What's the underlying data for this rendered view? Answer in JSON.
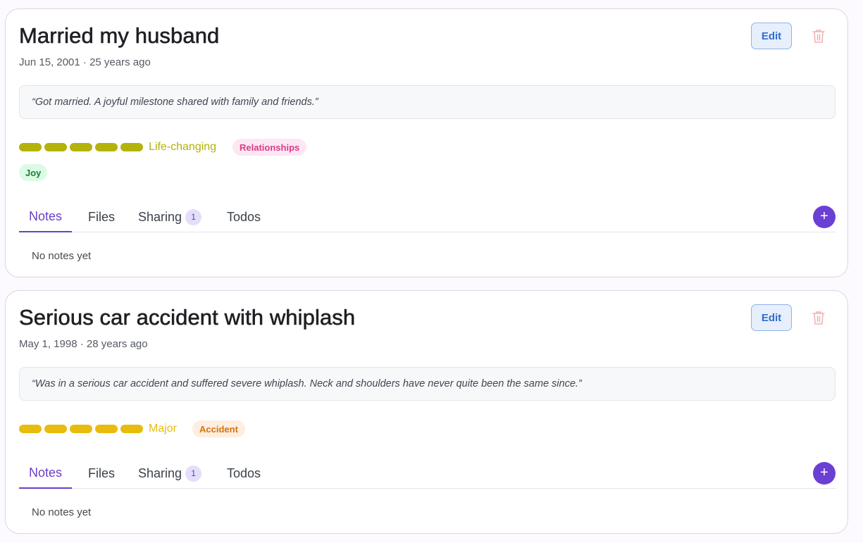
{
  "events": [
    {
      "title": "Married my husband",
      "date": "Jun 15, 2001 · 25 years ago",
      "edit_label": "Edit",
      "quote": "“Got married. A joyful milestone shared with family and friends.”",
      "intensity": {
        "label": "Life-changing",
        "level": 5,
        "max": 5,
        "color": "#b3b30b"
      },
      "category": {
        "label": "Relationships",
        "bg": "#fde7f2",
        "color": "#d63c8a"
      },
      "emotion": {
        "label": "Joy",
        "bg": "#dcfbe4",
        "color": "#1f7a3d"
      },
      "tabs": {
        "notes": "Notes",
        "files": "Files",
        "sharing": "Sharing",
        "sharing_count": "1",
        "todos": "Todos"
      },
      "add_label": "+",
      "empty_text": "No notes yet"
    },
    {
      "title": "Serious car accident with whiplash",
      "date": "May 1, 1998 · 28 years ago",
      "edit_label": "Edit",
      "quote": "“Was in a serious car accident and suffered severe whiplash. Neck and shoulders have never quite been the same since.”",
      "intensity": {
        "label": "Major",
        "level": 5,
        "max": 5,
        "color": "#e8bc0c"
      },
      "category": {
        "label": "Accident",
        "bg": "#fdeedf",
        "color": "#d9720b"
      },
      "tabs": {
        "notes": "Notes",
        "files": "Files",
        "sharing": "Sharing",
        "sharing_count": "1",
        "todos": "Todos"
      },
      "add_label": "+",
      "empty_text": "No notes yet"
    }
  ],
  "colors": {
    "accent": "#6a3fc9",
    "edit_bg": "#e6effb",
    "edit_text": "#2f6dd0",
    "trash": "#f2b3b3"
  }
}
